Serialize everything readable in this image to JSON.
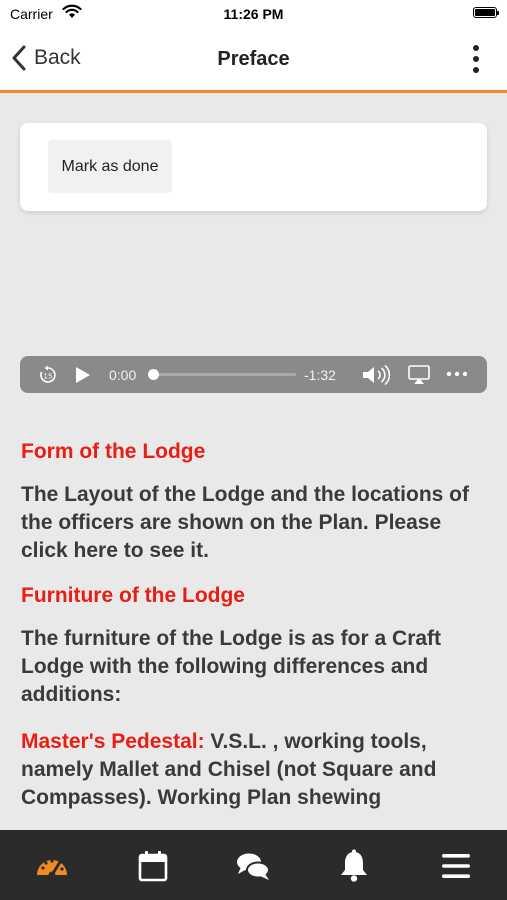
{
  "status_bar": {
    "carrier": "Carrier",
    "time": "11:26 PM"
  },
  "nav": {
    "back_label": "Back",
    "title": "Preface"
  },
  "card": {
    "mark_done_label": "Mark as done"
  },
  "player": {
    "current_time": "0:00",
    "remaining_time": "-1:32",
    "progress": 0.0
  },
  "content": {
    "heading1": "Form of the Lodge",
    "para1": "The Layout of the Lodge and the locations of the officers are shown on the Plan. Please click here to see it.",
    "heading2": "Furniture of the Lodge",
    "para2": "The furniture of the Lodge is as for a Craft Lodge with the following differences and additions:",
    "para3_label": "Master's Pedestal:",
    "para3_text": " V.S.L. , working tools, namely Mallet and Chisel (not Square and Compasses). Working Plan shewing"
  },
  "tabs": [
    {
      "icon": "dashboard-icon",
      "active": true
    },
    {
      "icon": "calendar-icon",
      "active": false
    },
    {
      "icon": "chat-icon",
      "active": false
    },
    {
      "icon": "bell-icon",
      "active": false
    },
    {
      "icon": "menu-icon",
      "active": false
    }
  ],
  "colors": {
    "accent": "#f08a24",
    "heading_red": "#e81e14",
    "tabbar": "#2b2b2b",
    "player": "#8a8a8a"
  }
}
